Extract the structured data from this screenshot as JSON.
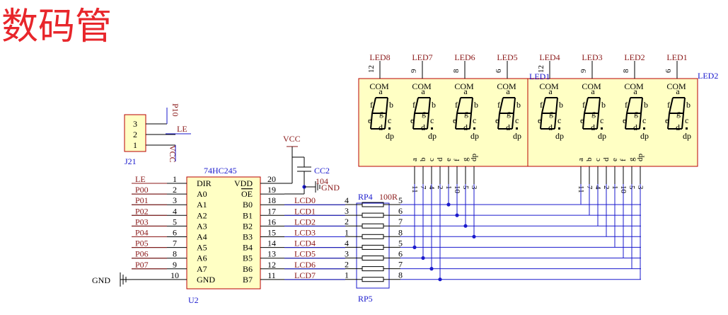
{
  "title": "数码管",
  "j21": {
    "ref": "J21",
    "pin_numbers": [
      "3",
      "2",
      "1"
    ],
    "nets": [
      "P10",
      "LE",
      "VCC"
    ]
  },
  "u2": {
    "part": "74HC245",
    "ref": "U2",
    "left_pins": [
      {
        "num": "1",
        "name": "DIR",
        "net": "LE"
      },
      {
        "num": "2",
        "name": "A0",
        "net": "P00"
      },
      {
        "num": "3",
        "name": "A1",
        "net": "P01"
      },
      {
        "num": "4",
        "name": "A2",
        "net": "P02"
      },
      {
        "num": "5",
        "name": "A3",
        "net": "P03"
      },
      {
        "num": "6",
        "name": "A4",
        "net": "P04"
      },
      {
        "num": "7",
        "name": "A5",
        "net": "P05"
      },
      {
        "num": "8",
        "name": "A6",
        "net": "P06"
      },
      {
        "num": "9",
        "name": "A7",
        "net": "P07"
      },
      {
        "num": "10",
        "name": "GND",
        "net": ""
      }
    ],
    "right_pins": [
      {
        "num": "20",
        "name": "VDD",
        "net": ""
      },
      {
        "num": "19",
        "name": "OE",
        "net": ""
      },
      {
        "num": "18",
        "name": "B0",
        "net": "LCD0"
      },
      {
        "num": "17",
        "name": "B1",
        "net": "LCD1"
      },
      {
        "num": "16",
        "name": "B2",
        "net": "LCD2"
      },
      {
        "num": "15",
        "name": "B3",
        "net": "LCD3"
      },
      {
        "num": "14",
        "name": "B4",
        "net": "LCD4"
      },
      {
        "num": "13",
        "name": "B5",
        "net": "LCD5"
      },
      {
        "num": "12",
        "name": "B6",
        "net": "LCD6"
      },
      {
        "num": "11",
        "name": "B7",
        "net": "LCD7"
      }
    ],
    "gnd_label": "GND"
  },
  "vcc_label": "VCC",
  "cap": {
    "ref": "CC2",
    "value": "104",
    "gnd": "GND"
  },
  "rp4": {
    "ref": "RP4",
    "value": "100R",
    "left_nums": [
      "4",
      "3",
      "2",
      "1"
    ],
    "right_nums": [
      "5",
      "6",
      "7",
      "8"
    ]
  },
  "rp5": {
    "ref": "RP5",
    "left_nums": [
      "4",
      "3",
      "2",
      "1"
    ],
    "right_nums": [
      "5",
      "6",
      "7",
      "8"
    ]
  },
  "led_labels": [
    "LED8",
    "LED7",
    "LED6",
    "LED5",
    "LED4",
    "LED3",
    "LED2",
    "LED1"
  ],
  "led_com_pins": [
    "12",
    "9",
    "8",
    "6",
    "12",
    "9",
    "8",
    "6"
  ],
  "led_blocks": [
    "LED1",
    "LED2"
  ],
  "digit": {
    "com": "COM",
    "segs": [
      "a",
      "b",
      "c",
      "d",
      "e",
      "f",
      "g"
    ],
    "dp": "dp"
  },
  "seg_pin_labels": [
    "a",
    "b",
    "c",
    "d",
    "e",
    "f",
    "g",
    "dp"
  ],
  "seg_pin_numbers": [
    "11",
    "7",
    "4",
    "2",
    "1",
    "10",
    "5",
    "3"
  ]
}
